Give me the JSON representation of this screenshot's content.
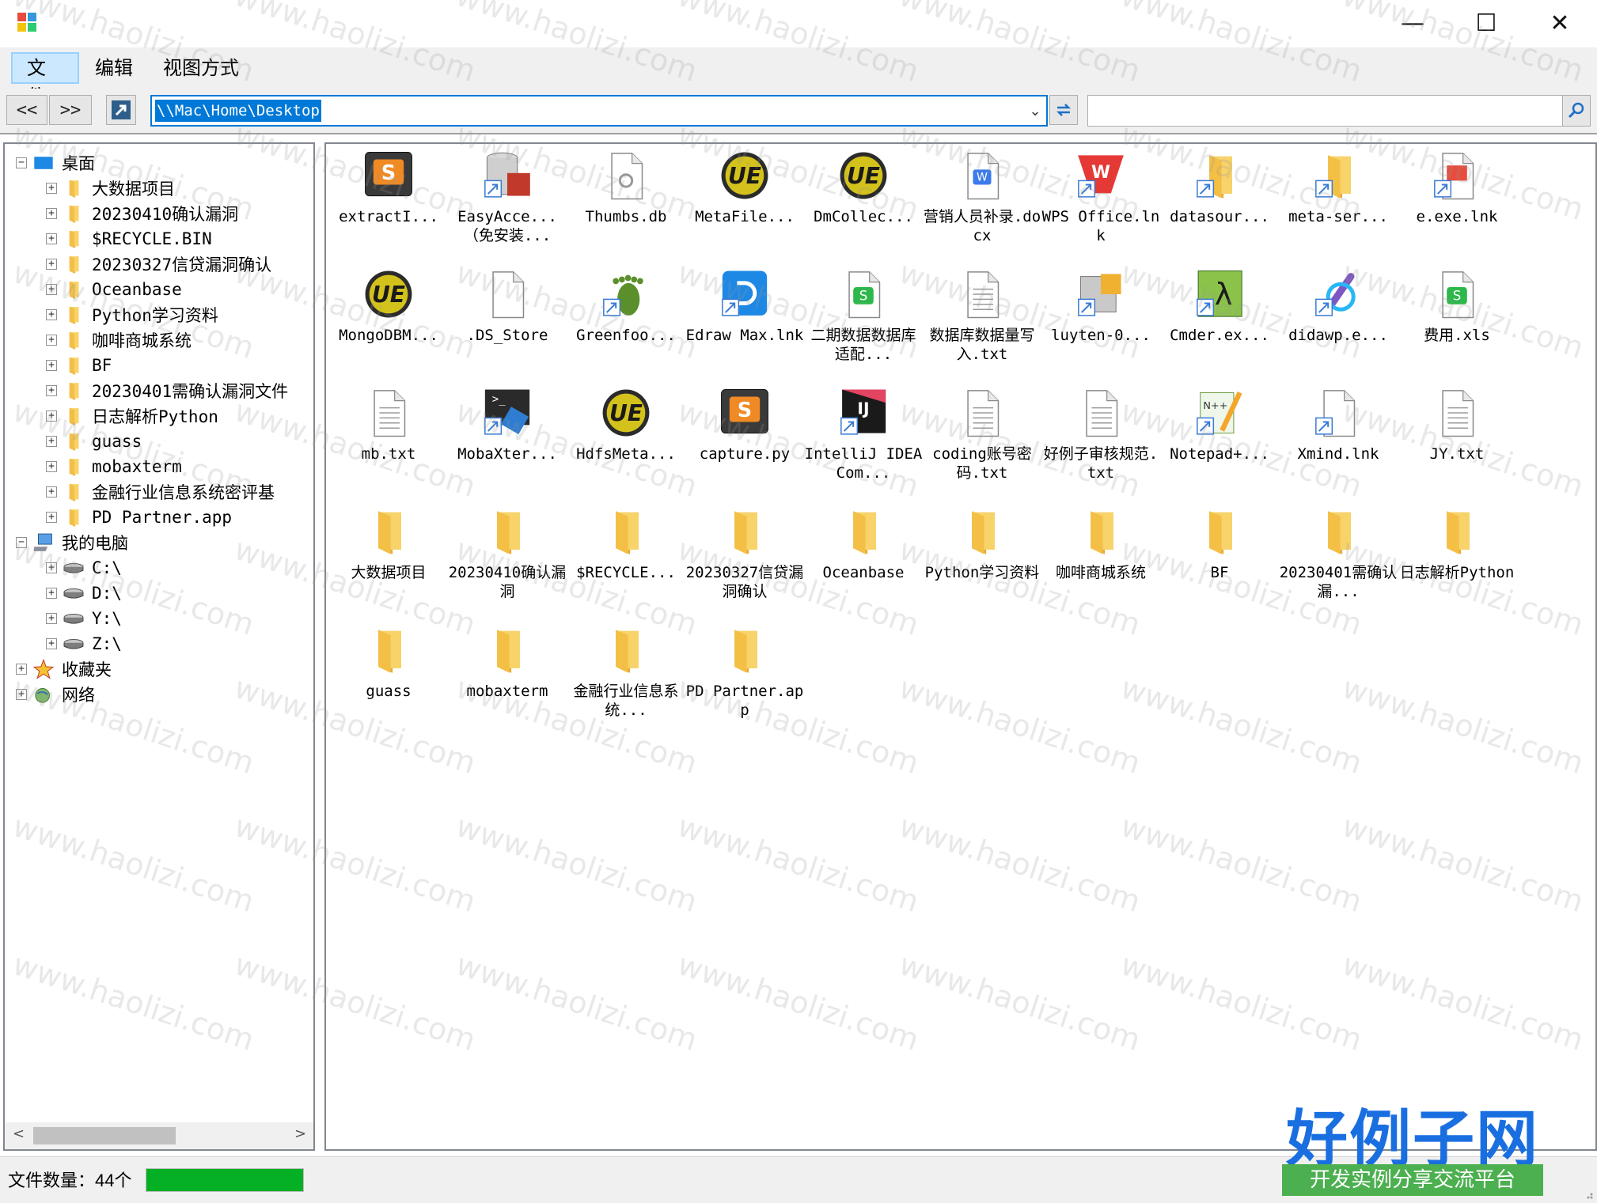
{
  "window": {
    "minimize": "—",
    "maximize": "☐",
    "close": "✕"
  },
  "menu": {
    "items": [
      "文件",
      "编辑",
      "视图方式"
    ]
  },
  "toolbar": {
    "back": "<<",
    "forward": ">>",
    "address": "\\\\Mac\\Home\\Desktop",
    "search_value": ""
  },
  "tree": [
    {
      "label": "桌面",
      "icon": "desktop-icon",
      "level": 0,
      "expander": "−"
    },
    {
      "label": "大数据项目",
      "icon": "folder-icon",
      "level": 1,
      "expander": "+"
    },
    {
      "label": "20230410确认漏洞",
      "icon": "folder-icon",
      "level": 1,
      "expander": "+"
    },
    {
      "label": "$RECYCLE.BIN",
      "icon": "folder-icon",
      "level": 1,
      "expander": "+"
    },
    {
      "label": "20230327信贷漏洞确认",
      "icon": "folder-icon",
      "level": 1,
      "expander": "+"
    },
    {
      "label": "Oceanbase",
      "icon": "folder-icon",
      "level": 1,
      "expander": "+"
    },
    {
      "label": "Python学习资料",
      "icon": "folder-icon",
      "level": 1,
      "expander": "+"
    },
    {
      "label": "咖啡商城系统",
      "icon": "folder-icon",
      "level": 1,
      "expander": "+"
    },
    {
      "label": "BF",
      "icon": "folder-icon",
      "level": 1,
      "expander": "+"
    },
    {
      "label": "20230401需确认漏洞文件",
      "icon": "folder-icon",
      "level": 1,
      "expander": "+"
    },
    {
      "label": "日志解析Python",
      "icon": "folder-icon",
      "level": 1,
      "expander": "+"
    },
    {
      "label": "guass",
      "icon": "folder-icon",
      "level": 1,
      "expander": "+"
    },
    {
      "label": "mobaxterm",
      "icon": "folder-icon",
      "level": 1,
      "expander": "+"
    },
    {
      "label": "金融行业信息系统密评基",
      "icon": "folder-icon",
      "level": 1,
      "expander": "+"
    },
    {
      "label": "PD Partner.app",
      "icon": "folder-icon",
      "level": 1,
      "expander": "+"
    },
    {
      "label": "我的电脑",
      "icon": "computer-icon",
      "level": 0,
      "expander": "−"
    },
    {
      "label": "C:\\",
      "icon": "drive-icon",
      "level": 1,
      "expander": "+"
    },
    {
      "label": "D:\\",
      "icon": "drive-icon",
      "level": 1,
      "expander": "+"
    },
    {
      "label": "Y:\\",
      "icon": "drive-icon",
      "level": 1,
      "expander": "+"
    },
    {
      "label": "Z:\\",
      "icon": "drive-icon",
      "level": 1,
      "expander": "+"
    },
    {
      "label": "收藏夹",
      "icon": "favorites-icon",
      "level": 0,
      "expander": "+"
    },
    {
      "label": "网络",
      "icon": "network-icon",
      "level": 0,
      "expander": "+"
    }
  ],
  "files": [
    {
      "name": "extractI...",
      "icon": "sublime-icon"
    },
    {
      "name": "EasyAcce...（免安装...",
      "icon": "database-icon"
    },
    {
      "name": "Thumbs.db",
      "icon": "settings-file-icon"
    },
    {
      "name": "MetaFile...",
      "icon": "ultraedit-icon"
    },
    {
      "name": "DmCollec...",
      "icon": "ultraedit-icon"
    },
    {
      "name": "营销人员补录.docx",
      "icon": "word-doc-icon"
    },
    {
      "name": "WPS Office.lnk",
      "icon": "wps-icon"
    },
    {
      "name": "datasour...",
      "icon": "folder-shortcut-icon"
    },
    {
      "name": "meta-ser...",
      "icon": "folder-shortcut-icon"
    },
    {
      "name": "e.exe.lnk",
      "icon": "exe-icon"
    },
    {
      "name": "MongoDBM...",
      "icon": "ultraedit-icon"
    },
    {
      "name": ".DS_Store",
      "icon": "blank-file-icon"
    },
    {
      "name": "Greenfoo...",
      "icon": "greenfoot-icon"
    },
    {
      "name": "Edraw Max.lnk",
      "icon": "edraw-icon"
    },
    {
      "name": "二期数据数据库适配...",
      "icon": "spreadsheet-icon"
    },
    {
      "name": "数据库数据量写入.txt",
      "icon": "text-file-icon"
    },
    {
      "name": "luyten-0...",
      "icon": "luyten-icon"
    },
    {
      "name": "Cmder.ex...",
      "icon": "cmder-icon"
    },
    {
      "name": "didawp.e...",
      "icon": "didawp-icon"
    },
    {
      "name": "费用.xls",
      "icon": "spreadsheet-icon"
    },
    {
      "name": "mb.txt",
      "icon": "text-file-icon"
    },
    {
      "name": "MobaXter...",
      "icon": "mobaxterm-icon"
    },
    {
      "name": "HdfsMeta...",
      "icon": "ultraedit-icon"
    },
    {
      "name": "capture.py",
      "icon": "sublime-icon"
    },
    {
      "name": "IntelliJ IDEA Com...",
      "icon": "intellij-icon"
    },
    {
      "name": "coding账号密码.txt",
      "icon": "text-file-icon"
    },
    {
      "name": "好例子审核规范.txt",
      "icon": "text-file-icon"
    },
    {
      "name": "Notepad+...",
      "icon": "notepadpp-icon"
    },
    {
      "name": "Xmind.lnk",
      "icon": "shortcut-file-icon"
    },
    {
      "name": "JY.txt",
      "icon": "text-file-icon"
    },
    {
      "name": "大数据项目",
      "icon": "folder-icon"
    },
    {
      "name": "20230410确认漏洞",
      "icon": "folder-icon"
    },
    {
      "name": "$RECYCLE...",
      "icon": "folder-icon"
    },
    {
      "name": "20230327信贷漏洞确认",
      "icon": "folder-icon"
    },
    {
      "name": "Oceanbase",
      "icon": "folder-icon"
    },
    {
      "name": "Python学习资料",
      "icon": "folder-icon"
    },
    {
      "name": "咖啡商城系统",
      "icon": "folder-icon"
    },
    {
      "name": "BF",
      "icon": "folder-icon"
    },
    {
      "name": "20230401需确认漏...",
      "icon": "folder-icon"
    },
    {
      "name": "日志解析Python",
      "icon": "folder-icon"
    },
    {
      "name": "guass",
      "icon": "folder-icon"
    },
    {
      "name": "mobaxterm",
      "icon": "folder-icon"
    },
    {
      "name": "金融行业信息系统...",
      "icon": "folder-icon"
    },
    {
      "name": "PD Partner.app",
      "icon": "folder-icon"
    }
  ],
  "status": {
    "count_text": "文件数量：44个",
    "progress": 1.0
  },
  "watermark": {
    "text": "www.haolizi.com"
  },
  "logo": {
    "title": "好例子网",
    "subtitle": "开发实例分享交流平台"
  },
  "colors": {
    "accent": "#0078d7",
    "selection": "#cce8ff",
    "progress": "#06b025",
    "folder": "#f7c855",
    "logo_blue": "#1a6fe0",
    "logo_green": "#4caf50"
  }
}
